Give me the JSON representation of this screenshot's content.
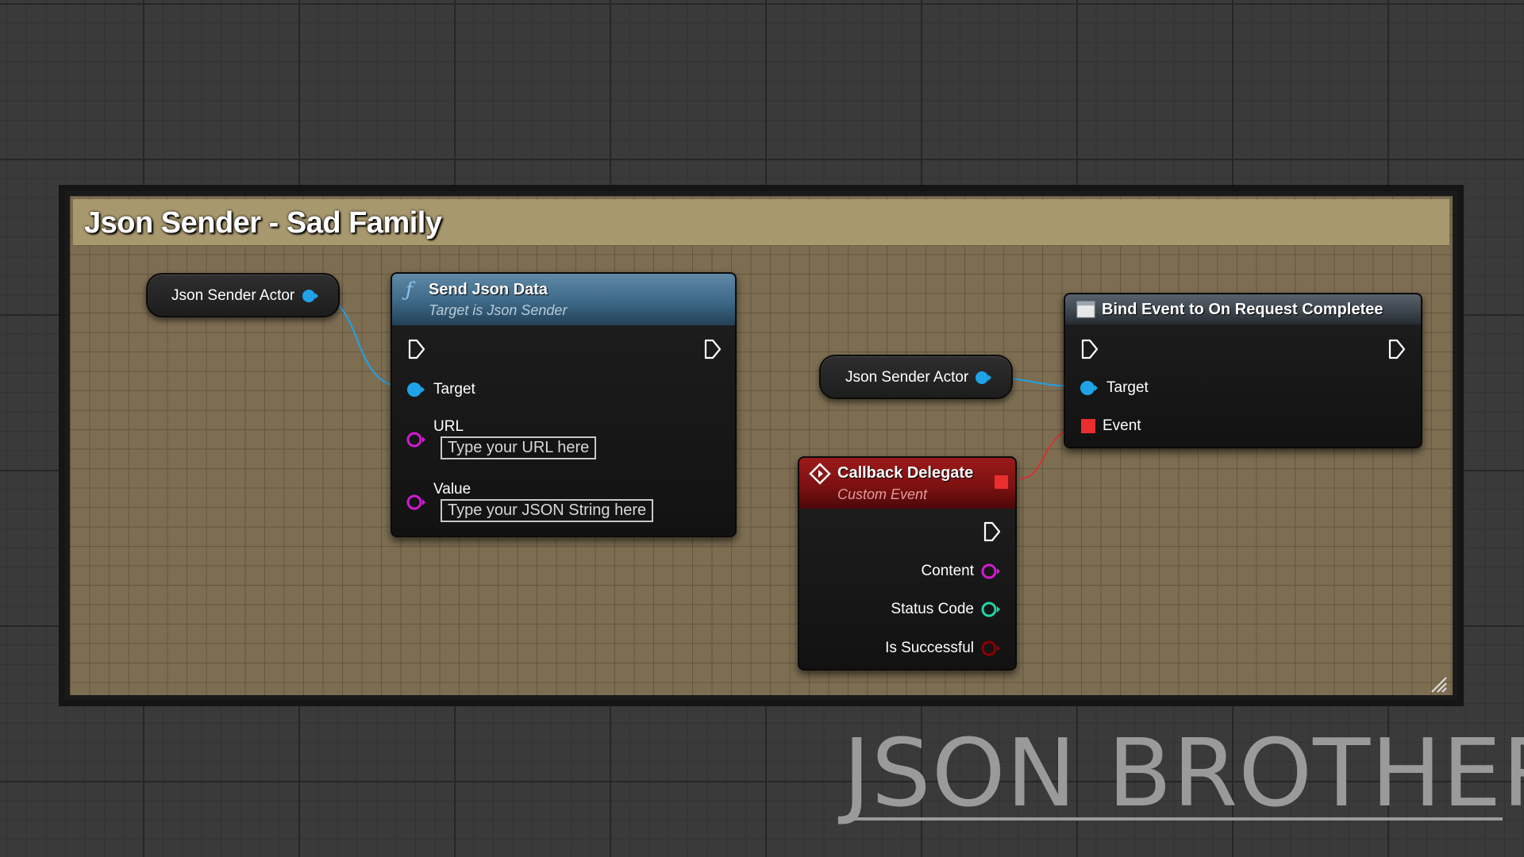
{
  "comment": {
    "title": "Json Sender - Sad Family"
  },
  "getter_left": {
    "label": "Json Sender Actor"
  },
  "getter_right": {
    "label": "Json Sender Actor"
  },
  "send_node": {
    "title": "Send Json Data",
    "subtitle": "Target is Json Sender",
    "icon": "function-icon",
    "pins": {
      "target": "Target",
      "url": "URL",
      "url_placeholder": "Type your URL here",
      "value": "Value",
      "value_placeholder": "Type your JSON String here"
    }
  },
  "bind_node": {
    "title": "Bind Event to On Request Completee",
    "icon": "bind-event-icon",
    "pins": {
      "target": "Target",
      "event": "Event"
    }
  },
  "callback_node": {
    "title": "Callback Delegate",
    "subtitle": "Custom Event",
    "icon": "custom-event-icon",
    "pins": {
      "content": "Content",
      "status_code": "Status Code",
      "is_successful": "Is Successful"
    }
  },
  "watermark": {
    "text": "JSON BROTHER"
  },
  "colors": {
    "object_pin": "#1fa3e8",
    "string_pin": "#d21bd2",
    "int_pin": "#21d6a2",
    "bool_pin": "#8c0000",
    "delegate_pin": "#ea2d2d",
    "exec_pin": "#ffffff",
    "comment_header": "#a8986e",
    "comment_body": "#7d6e52"
  }
}
